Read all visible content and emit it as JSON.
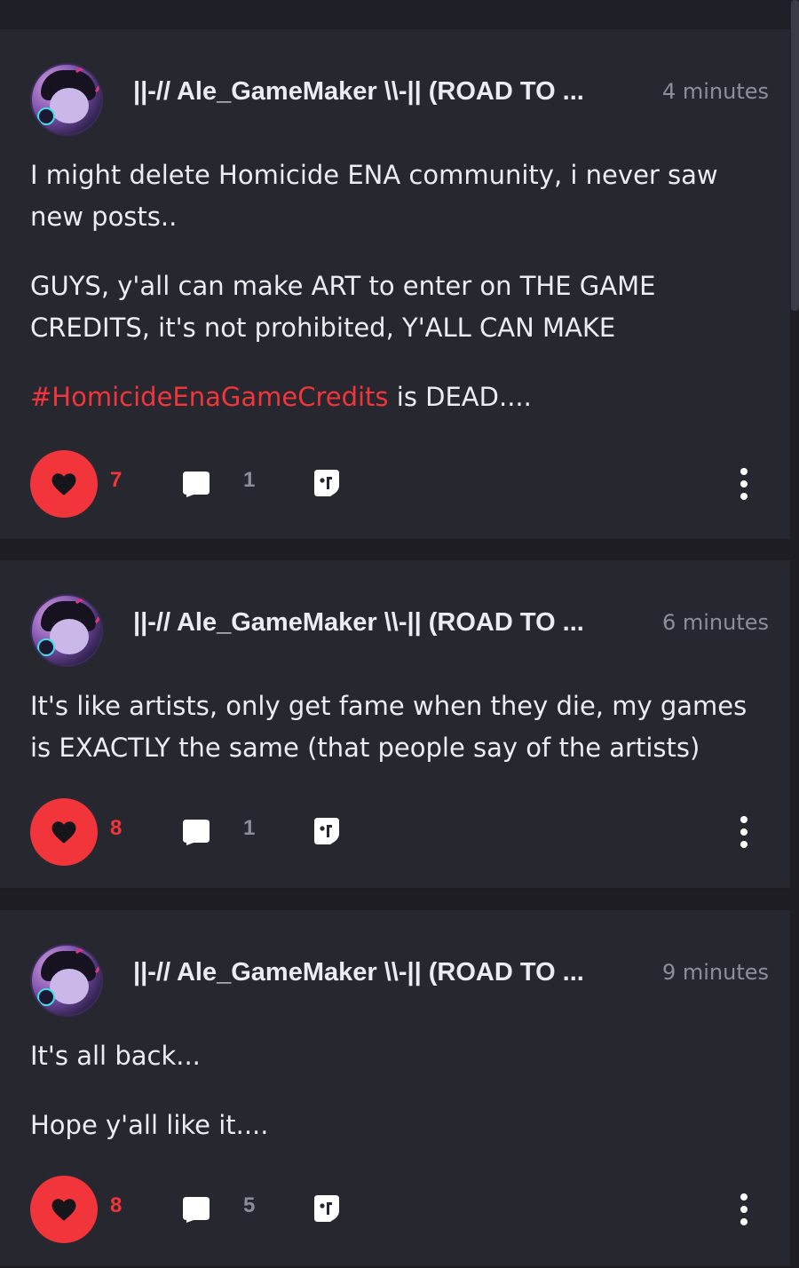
{
  "posts": [
    {
      "author": "||-// Ale_GameMaker \\\\-|| (ROAD TO ...",
      "time": "4 minutes",
      "paragraphs": [
        "I might delete Homicide ENA community, i never saw new posts..",
        "GUYS, y'all can make ART to enter on THE GAME CREDITS, it's not prohibited, Y'ALL CAN MAKE"
      ],
      "hashtag": "#HomicideEnaGameCredits",
      "hashtag_suffix": " is DEAD....",
      "likes": "7",
      "comments": "1"
    },
    {
      "author": "||-// Ale_GameMaker \\\\-|| (ROAD TO ...",
      "time": "6 minutes",
      "paragraphs": [
        "It's like artists, only get fame when they die, my games is EXACTLY the same (that people say of the artists)"
      ],
      "likes": "8",
      "comments": "1"
    },
    {
      "author": "||-// Ale_GameMaker \\\\-|| (ROAD TO ...",
      "time": "9 minutes",
      "paragraphs": [
        "It's all back...",
        "Hope y'all like it...."
      ],
      "likes": "8",
      "comments": "5"
    }
  ],
  "colors": {
    "background": "#1d1d23",
    "card": "#272730",
    "accent": "#f2353b",
    "text": "#ececf2",
    "muted": "#8d8e99"
  },
  "icons": [
    "heart-icon",
    "comment-icon",
    "share-icon",
    "more-options-icon"
  ]
}
